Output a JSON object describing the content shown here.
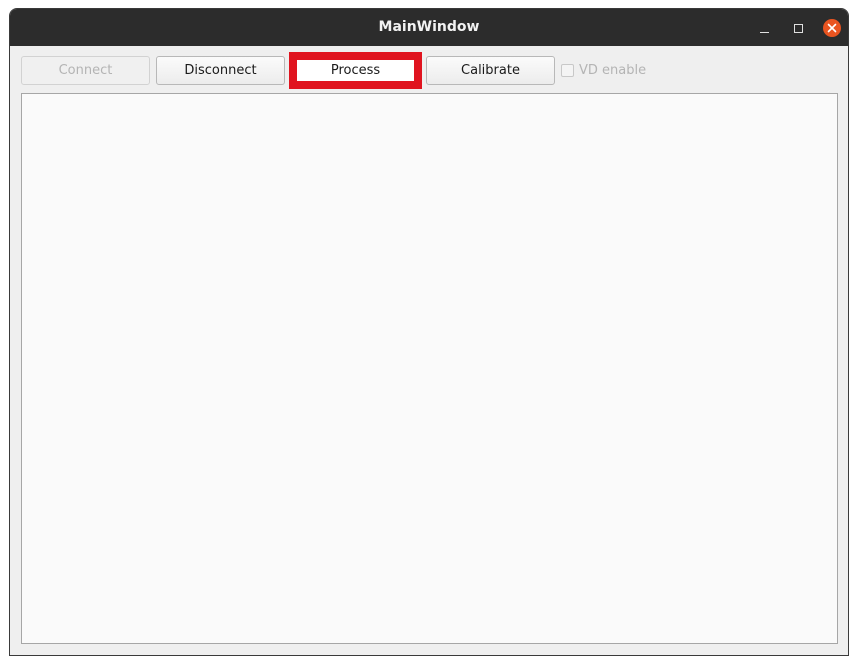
{
  "window": {
    "title": "MainWindow",
    "controls": {
      "minimize_icon": "minimize-icon",
      "maximize_icon": "maximize-icon",
      "close_icon": "close-icon",
      "close_color": "#e95420"
    }
  },
  "toolbar": {
    "connect_label": "Connect",
    "connect_enabled": false,
    "disconnect_label": "Disconnect",
    "process_label": "Process",
    "process_highlight_color": "#e0141f",
    "calibrate_label": "Calibrate",
    "vd_enable_label": "VD enable",
    "vd_enable_checked": false,
    "vd_enable_enabled": false
  },
  "content": {
    "text": ""
  }
}
